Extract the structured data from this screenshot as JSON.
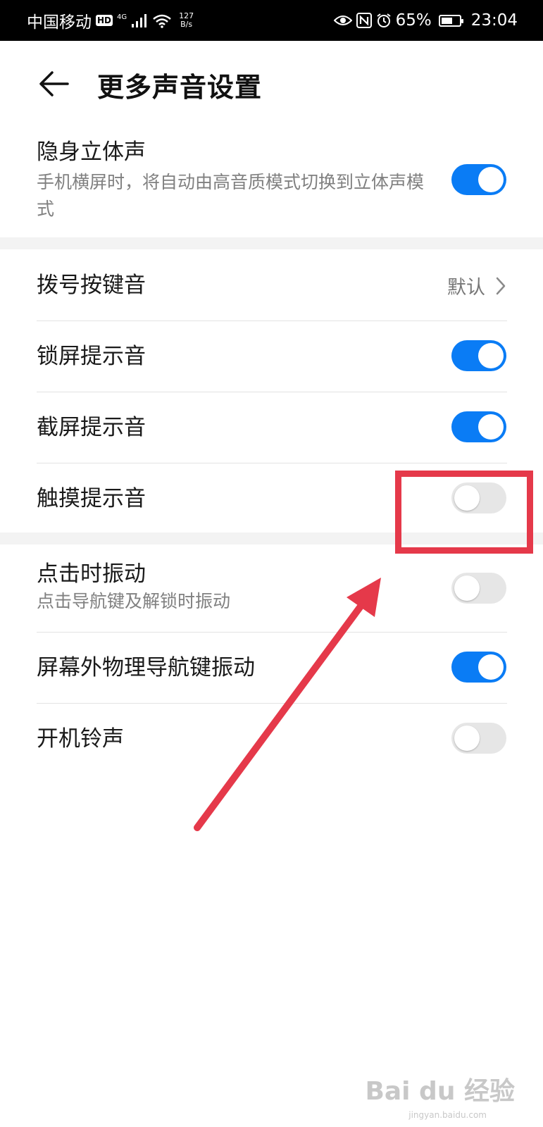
{
  "status_bar": {
    "carrier": "中国移动",
    "hd": "HD",
    "network": "4G",
    "speed_value": "127",
    "speed_unit": "B/s",
    "battery_percent": "65%",
    "battery_level": 0.65,
    "time": "23:04",
    "icons": [
      "eye-icon",
      "nfc-icon",
      "alarm-icon",
      "wifi-icon",
      "signal-icon",
      "battery-icon"
    ]
  },
  "header": {
    "title": "更多声音设置"
  },
  "settings": {
    "stealth_stereo": {
      "label": "隐身立体声",
      "subtitle": "手机横屏时，将自动由高音质模式切换到立体声模式",
      "enabled": true
    },
    "dial_tone": {
      "label": "拨号按键音",
      "value": "默认"
    },
    "lock_screen_tone": {
      "label": "锁屏提示音",
      "enabled": true
    },
    "screenshot_tone": {
      "label": "截屏提示音",
      "enabled": true
    },
    "touch_tone": {
      "label": "触摸提示音",
      "enabled": false
    },
    "vibrate_on_tap": {
      "label": "点击时振动",
      "subtitle": "点击导航键及解锁时振动",
      "enabled": false
    },
    "offscreen_nav_vibrate": {
      "label": "屏幕外物理导航键振动",
      "enabled": true
    },
    "boot_ringtone": {
      "label": "开机铃声",
      "enabled": false
    }
  },
  "colors": {
    "toggle_on": "#0a7cf5",
    "toggle_off": "#e6e6e6",
    "annotation": "#e5394a"
  },
  "watermark": {
    "text": "Bai du 经验",
    "sub": "jingyan.baidu.com"
  }
}
